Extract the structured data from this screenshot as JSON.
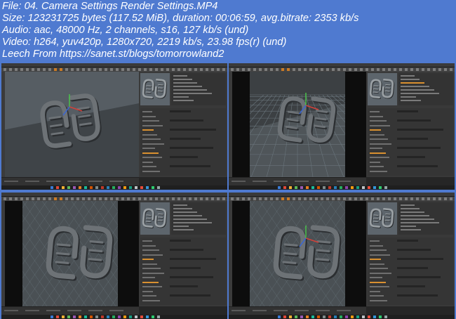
{
  "info": {
    "file_line": "File: 04. Camera Settings  Render Settings.MP4",
    "size_line": "Size: 123231725 bytes (117.52 MiB), duration: 00:06:59, avg.bitrate: 2353 kb/s",
    "audio_line": "Audio: aac, 48000 Hz, 2 channels, s16, 127 kb/s (und)",
    "video_line": "Video: h264, yuv420p, 1280x720, 2219 kb/s, 23.98 fps(r) (und)",
    "leech_line": "Leech From https://sanet.st/blogs/tomorrowland2"
  },
  "colors": {
    "page_background": "#4f7ad0",
    "info_text": "#ffffff",
    "app_dark": "#262626",
    "viewport_floor": "#4b4f52",
    "viewport_grid": "#5e6a72",
    "accent_orange": "#d99030"
  },
  "frames": [
    {
      "name": "frame-1",
      "view": "perspective-shaded"
    },
    {
      "name": "frame-2",
      "view": "perspective-grid"
    },
    {
      "name": "frame-3",
      "view": "camera-grid-framed"
    },
    {
      "name": "frame-4",
      "view": "camera-grid-framed"
    }
  ],
  "icons": [
    "c4d-viewport",
    "object-manager",
    "attribute-manager",
    "timeline",
    "taskbar-app-icons",
    "move-gizmo-icon"
  ]
}
